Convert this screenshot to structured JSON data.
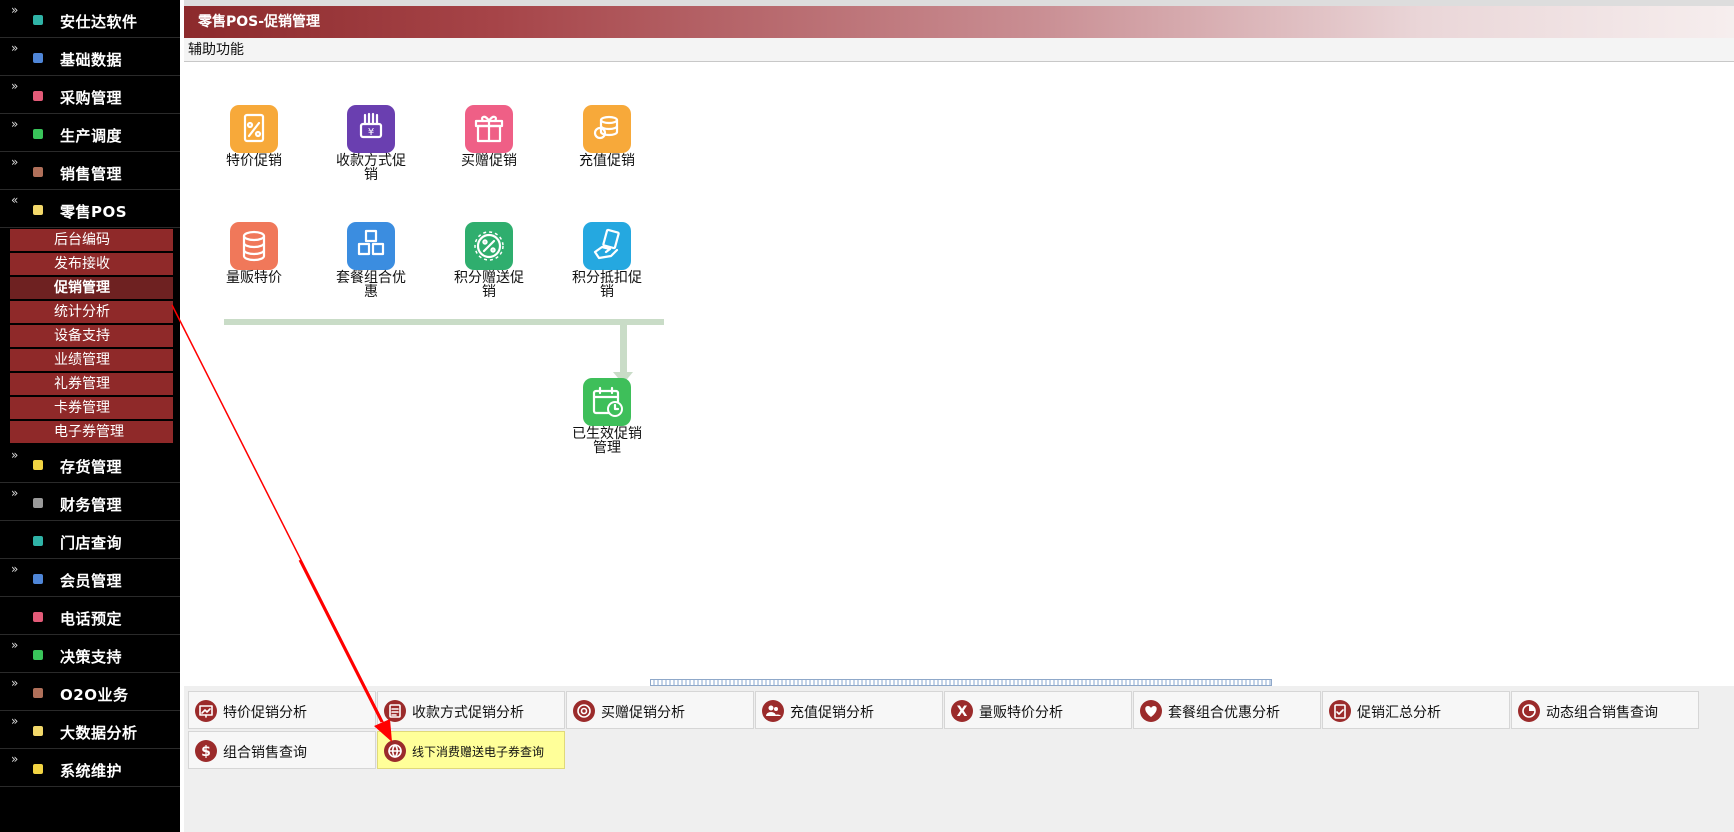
{
  "sidebar": {
    "items_top": [
      {
        "label": "安仕达软件",
        "chevron": "»",
        "color": "#2fb3a7"
      },
      {
        "label": "基础数据",
        "chevron": "»",
        "color": "#4f86d8"
      },
      {
        "label": "采购管理",
        "chevron": "»",
        "color": "#e35b78"
      },
      {
        "label": "生产调度",
        "chevron": "»",
        "color": "#39c45a"
      },
      {
        "label": "销售管理",
        "chevron": "»",
        "color": "#b0705a"
      },
      {
        "label": "零售POS",
        "chevron": "«",
        "color": "#f2d86a"
      }
    ],
    "submenu": [
      {
        "label": "后台编码"
      },
      {
        "label": "发布接收"
      },
      {
        "label": "促销管理",
        "active": true
      },
      {
        "label": "统计分析"
      },
      {
        "label": "设备支持"
      },
      {
        "label": "业绩管理"
      },
      {
        "label": "礼券管理"
      },
      {
        "label": "卡券管理"
      },
      {
        "label": "电子券管理"
      }
    ],
    "items_bottom": [
      {
        "label": "存货管理",
        "chevron": "»",
        "color": "#f2d443"
      },
      {
        "label": "财务管理",
        "chevron": "»",
        "color": "#9a9a9a"
      },
      {
        "label": "门店查询",
        "chevron": "",
        "color": "#2fb3a7"
      },
      {
        "label": "会员管理",
        "chevron": "»",
        "color": "#4f86d8"
      },
      {
        "label": "电话预定",
        "chevron": "",
        "color": "#e35b78"
      },
      {
        "label": "决策支持",
        "chevron": "»",
        "color": "#39c45a"
      },
      {
        "label": "O2O业务",
        "chevron": "»",
        "color": "#b0705a"
      },
      {
        "label": "大数据分析",
        "chevron": "»",
        "color": "#f2d86a"
      },
      {
        "label": "系统维护",
        "chevron": "»",
        "color": "#f2d443"
      }
    ]
  },
  "header": {
    "title": "零售POS-促销管理",
    "menu_label": "辅助功能"
  },
  "flow": {
    "icons": [
      {
        "label": "特价促销",
        "icon": "percent-doc-icon",
        "color": "#f7a93a"
      },
      {
        "label": "收款方式促销",
        "icon": "cash-hand-icon",
        "color": "#6a3fb0"
      },
      {
        "label": "买赠促销",
        "icon": "gift-icon",
        "color": "#ef5f86"
      },
      {
        "label": "充值促销",
        "icon": "coins-icon",
        "color": "#f7a93a"
      },
      {
        "label": "量贩特价",
        "icon": "database-icon",
        "color": "#f0785a"
      },
      {
        "label": "套餐组合优惠",
        "icon": "cubes-icon",
        "color": "#3b8de0"
      },
      {
        "label": "积分赠送促销",
        "icon": "percent-badge-icon",
        "color": "#2fae6e"
      },
      {
        "label": "积分抵扣促销",
        "icon": "hand-money-icon",
        "color": "#25a8e0"
      },
      {
        "label": "已生效促销管理",
        "icon": "calendar-clock-icon",
        "color": "#3ebf5a"
      }
    ]
  },
  "reports": [
    {
      "label": "特价促销分析",
      "icon": "chart-board-icon"
    },
    {
      "label": "收款方式促销分析",
      "icon": "clipboard-icon"
    },
    {
      "label": "买赠促销分析",
      "icon": "lifebuoy-icon"
    },
    {
      "label": "充值促销分析",
      "icon": "users-icon"
    },
    {
      "label": "量贩特价分析",
      "icon": "x-icon"
    },
    {
      "label": "套餐组合优惠分析",
      "icon": "heart-icon"
    },
    {
      "label": "促销汇总分析",
      "icon": "clipboard-check-icon"
    },
    {
      "label": "动态组合销售查询",
      "icon": "pie-icon"
    },
    {
      "label": "组合销售查询",
      "icon": "dollar-icon"
    },
    {
      "label": "线下消费赠送电子券查询",
      "icon": "basketball-icon",
      "highlighted": true
    }
  ],
  "colors": {
    "accent_red": "#9b2b2b",
    "submenu_bg": "#8f2929",
    "flow_line": "#c9dcc7",
    "highlight_yellow": "#ffff99",
    "annotation_arrow": "#ff0000"
  }
}
